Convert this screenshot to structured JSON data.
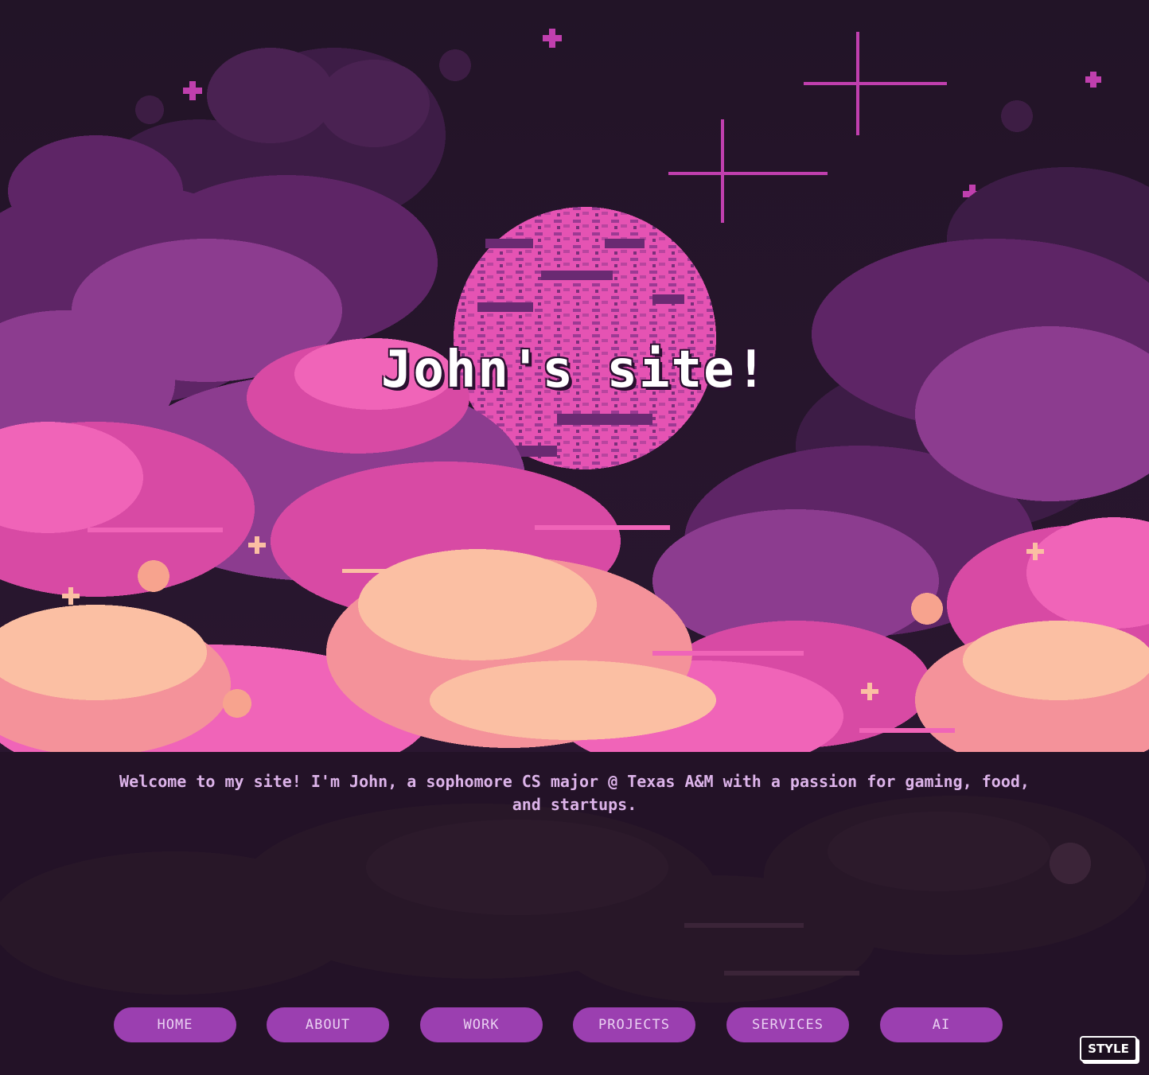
{
  "hero": {
    "title": "John's site!"
  },
  "intro": {
    "text": "Welcome to my site! I'm John, a sophomore CS major @ Texas A&M with a passion for gaming, food, and startups."
  },
  "nav": {
    "items": [
      {
        "label": "HOME"
      },
      {
        "label": "ABOUT"
      },
      {
        "label": "WORK"
      },
      {
        "label": "PROJECTS"
      },
      {
        "label": "SERVICES"
      },
      {
        "label": "AI"
      }
    ]
  },
  "style_toggle": {
    "label": "STYLE"
  },
  "colors": {
    "sky": "#221427",
    "cloud_dark": "#5e2566",
    "cloud_mid": "#8c3c8f",
    "cloud_pink": "#e04fa8",
    "cloud_hot": "#f064b8",
    "cloud_peach": "#f7a38e",
    "cloud_cream": "#fbbfa3",
    "moon": "#f05ab9",
    "button_bg": "#9b3fb0",
    "intro_text": "#ddb4ea"
  },
  "scene": {
    "illustration": "pixel-art night sky with moon, stars and clouds"
  }
}
